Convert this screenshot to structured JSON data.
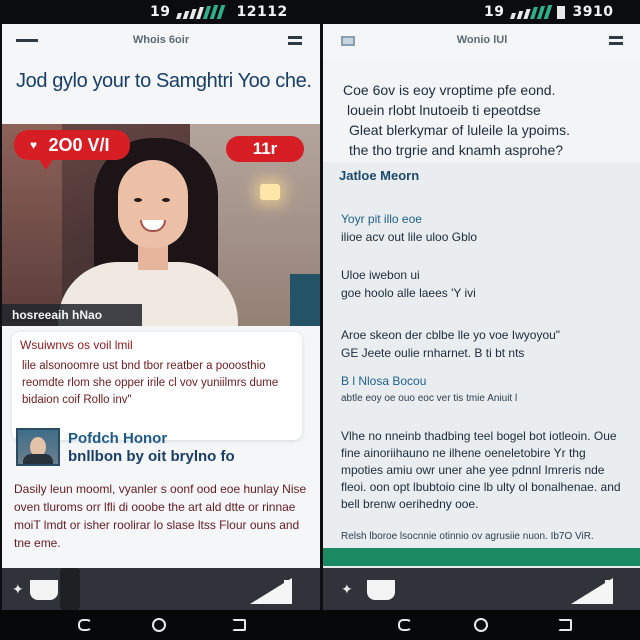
{
  "status_bar": {
    "left_time": "19",
    "right_time": "19",
    "left_clock": "12112",
    "right_clock": "3910"
  },
  "left_phone": {
    "appbar_title": "Whois 6oir",
    "headline": "Jod gylo your to Samghtri Yoo che.",
    "photo": {
      "bubble_left": "2O0 V/I",
      "bubble_right": "11r",
      "caption": "hosreeaih hNao"
    },
    "card": {
      "title": "Wsuiwnvs os voil lmil",
      "body": "lile alsonoomre ust bnd tbor reatber a pooosthio reomdte rlom she opper irile cl vov yuniilmrs dume bidaion coif Rollo inv\""
    },
    "author": {
      "name": "Pofdch Honor",
      "subtitle": "bnllbon by oit brylno fo"
    },
    "article": "Dasily leun mooml, vyanler s oonf ood eoe hunlay Nise oven tluroms orr lfli di ooobe the art ald dtte or rinnae moiT lmdt or isher roolirar lo slase ltss Flour ouns and tne eme."
  },
  "right_phone": {
    "appbar_title": "Wonio lUl",
    "intro_lines": [
      "Coe 6ov is eoy vroptime pfe eond.",
      "louein rlobt lnutoeib ti epeotdse",
      "Gleat blerkymar of luleile la ypoims.",
      "the tho trgrie and knamh asprohe?"
    ],
    "section_title": "Jatloe Meorn",
    "blocks": [
      {
        "heading": "Yoyr pit illo eoe",
        "line": "ilioe acv out lile uloo Gblo"
      },
      {
        "heading": "Uloe iwebon ui",
        "line": "goe hoolo alle laees 'Y ivi"
      },
      {
        "heading": "Aroe skeon der cblbe lle yo voe Iwyoyou\"",
        "line": "GE Jeete oulie rnharnet. B ti bt nts"
      },
      {
        "heading": "B l Nlosa Bocou",
        "line": "abtle eoy oe ouo eoc ver tis tmie Aniuit l"
      }
    ],
    "paragraph": "Vlhe no nneinb thadbing teel bogel bot iotleoin. Oue fine ainoriihauno ne ilhene oeneletobire Yr thg mpoties amiu owr uner ahe yee pdnnl Imreris nde fleoi. oon opt lbubtoio cine lb ulty ol bonalhenae. and bell brenw oerihedny ooe.",
    "footer_line": "Relsh lboroe lsocnnie otinnio ov agrusiie nuon. Ib7O ViR."
  },
  "icons": {
    "left_menu": "hamburger-icon",
    "status_signal": "signal-icon",
    "nav_back": "back-icon",
    "nav_home": "home-icon",
    "nav_recent": "recent-apps-icon"
  },
  "colors": {
    "headline_blue": "#1a3e68",
    "accent_red": "#d81e25",
    "accent_green": "#1b8a63",
    "body_maroon": "#621c22"
  }
}
